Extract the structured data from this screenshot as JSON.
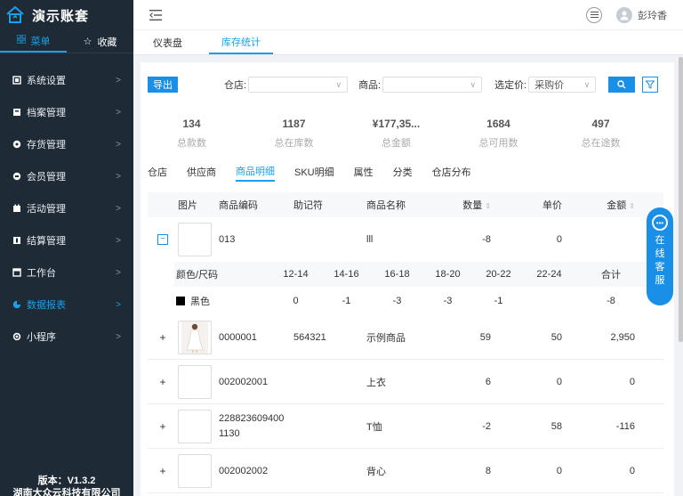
{
  "brand": {
    "name": "演示账套"
  },
  "sidebar": {
    "tabs": [
      {
        "label": "菜单",
        "icon": "grid-icon"
      },
      {
        "label": "收藏",
        "icon": "star-icon"
      }
    ],
    "items": [
      {
        "label": "系统设置"
      },
      {
        "label": "档案管理"
      },
      {
        "label": "存货管理"
      },
      {
        "label": "会员管理"
      },
      {
        "label": "活动管理"
      },
      {
        "label": "结算管理"
      },
      {
        "label": "工作台"
      },
      {
        "label": "数据报表"
      },
      {
        "label": "小程序"
      }
    ],
    "version": "版本：V1.3.2",
    "company": "湖南大众云科技有限公司"
  },
  "header": {
    "user": "彭玲香"
  },
  "page_tabs": [
    "仪表盘",
    "库存统计"
  ],
  "filters": {
    "export_label": "导出",
    "warehouse_label": "仓店:",
    "product_label": "商品:",
    "price_label": "选定价:",
    "price_value": "采购价"
  },
  "stats": [
    {
      "value": "134",
      "label": "总款数"
    },
    {
      "value": "1187",
      "label": "总在库数"
    },
    {
      "value": "¥177,35...",
      "label": "总金额"
    },
    {
      "value": "1684",
      "label": "总可用数"
    },
    {
      "value": "497",
      "label": "总在途数"
    }
  ],
  "sub_tabs": [
    "仓店",
    "供应商",
    "商品明细",
    "SKU明细",
    "属性",
    "分类",
    "仓店分布"
  ],
  "table": {
    "columns": [
      "图片",
      "商品编码",
      "助记符",
      "商品名称",
      "数量",
      "单价",
      "金额"
    ],
    "expanded_row": {
      "code": "013",
      "memo": "",
      "name": "lll",
      "qty": "-8",
      "price": "0",
      "amount": ""
    },
    "nested": {
      "header_first": "颜色/尺码",
      "sizes": [
        "12-14",
        "14-16",
        "16-18",
        "18-20",
        "20-22",
        "22-24"
      ],
      "total_label": "合计",
      "rows": [
        {
          "color": "黑色",
          "values": [
            "0",
            "-1",
            "-3",
            "-3",
            "-1",
            ""
          ],
          "total": "-8"
        }
      ]
    },
    "rows": [
      {
        "code": "0000001",
        "memo": "564321",
        "name": "示例商品",
        "qty": "59",
        "price": "50",
        "amount": "2,950"
      },
      {
        "code": "002002001",
        "memo": "",
        "name": "上衣",
        "qty": "6",
        "price": "0",
        "amount": "0"
      },
      {
        "code": "2288236094001130",
        "code_l1": "228823609400",
        "code_l2": "1130",
        "memo": "",
        "name": "T恤",
        "qty": "-2",
        "price": "58",
        "amount": "-116"
      },
      {
        "code": "002002002",
        "memo": "",
        "name": "背心",
        "qty": "8",
        "price": "0",
        "amount": "0"
      }
    ]
  },
  "customer_service": {
    "chars": [
      "在",
      "线",
      "客",
      "服"
    ]
  }
}
